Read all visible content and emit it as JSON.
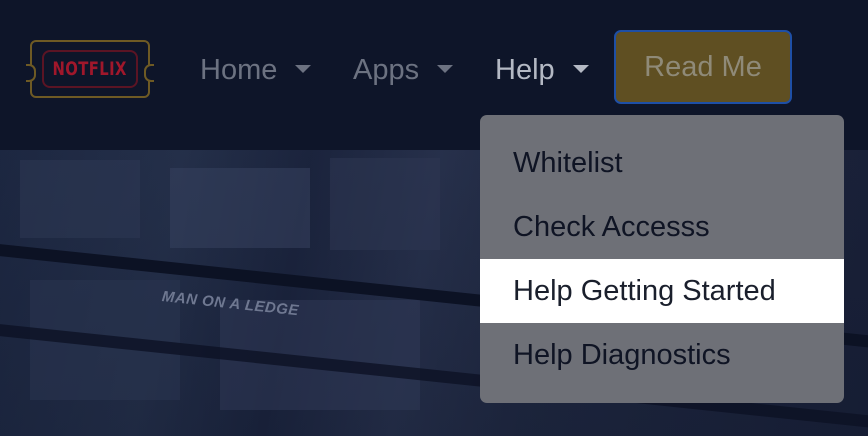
{
  "background": {
    "poster_caption": "MAN ON A LEDGE"
  },
  "navbar": {
    "logo_text": "NOTFLIX",
    "items": [
      {
        "label": "Home",
        "icon": "caret-down-icon"
      },
      {
        "label": "Apps",
        "icon": "caret-down-icon"
      },
      {
        "label": "Help",
        "icon": "caret-down-icon",
        "state": "open"
      }
    ],
    "readme_label": "Read Me"
  },
  "help_menu": {
    "items": [
      {
        "label": "Whitelist"
      },
      {
        "label": "Check Accesss"
      },
      {
        "label": "Help Getting Started",
        "highlighted": true
      },
      {
        "label": "Help Diagnostics"
      }
    ]
  },
  "colors": {
    "page_background": "#0e1529",
    "readme_button": "#5f4f22",
    "readme_border": "#1e4fa6",
    "dropdown_background": "#6e7077",
    "highlight": "#ffffff",
    "logo_red": "#a0172b"
  }
}
